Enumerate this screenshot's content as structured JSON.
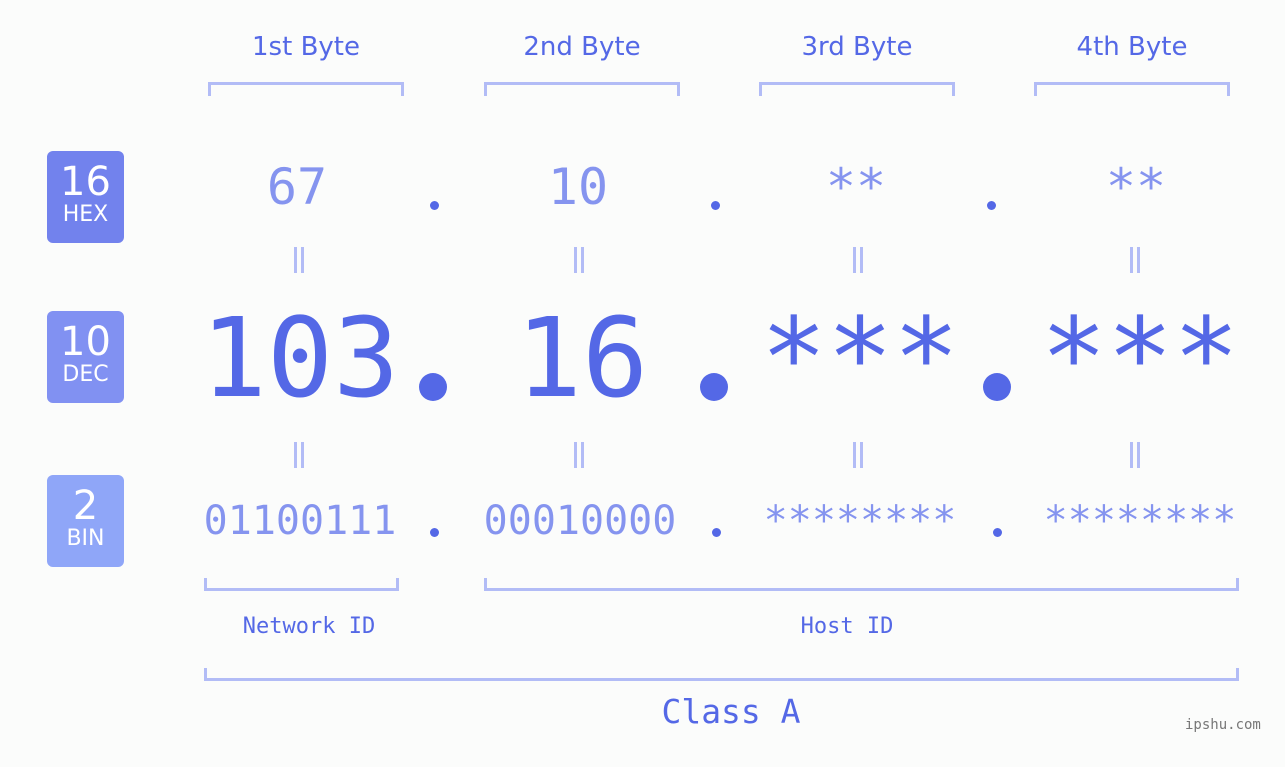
{
  "byte_headers": [
    "1st Byte",
    "2nd Byte",
    "3rd Byte",
    "4th Byte"
  ],
  "badges": [
    {
      "number": "16",
      "label": "HEX",
      "color": "#7282ed"
    },
    {
      "number": "10",
      "label": "DEC",
      "color": "#8191f2"
    },
    {
      "number": "2",
      "label": "BIN",
      "color": "#8fa6f8"
    }
  ],
  "hex": [
    "67",
    "10",
    "**",
    "**"
  ],
  "dec": [
    "103",
    "16",
    "***",
    "***"
  ],
  "bin": [
    "01100111",
    "00010000",
    "********",
    "********"
  ],
  "network_label": "Network ID",
  "host_label": "Host ID",
  "class_label": "Class A",
  "watermark": "ipshu.com",
  "colors": {
    "primary": "#5468e6",
    "light": "#8594ef",
    "bracket": "#b2bcf6"
  }
}
